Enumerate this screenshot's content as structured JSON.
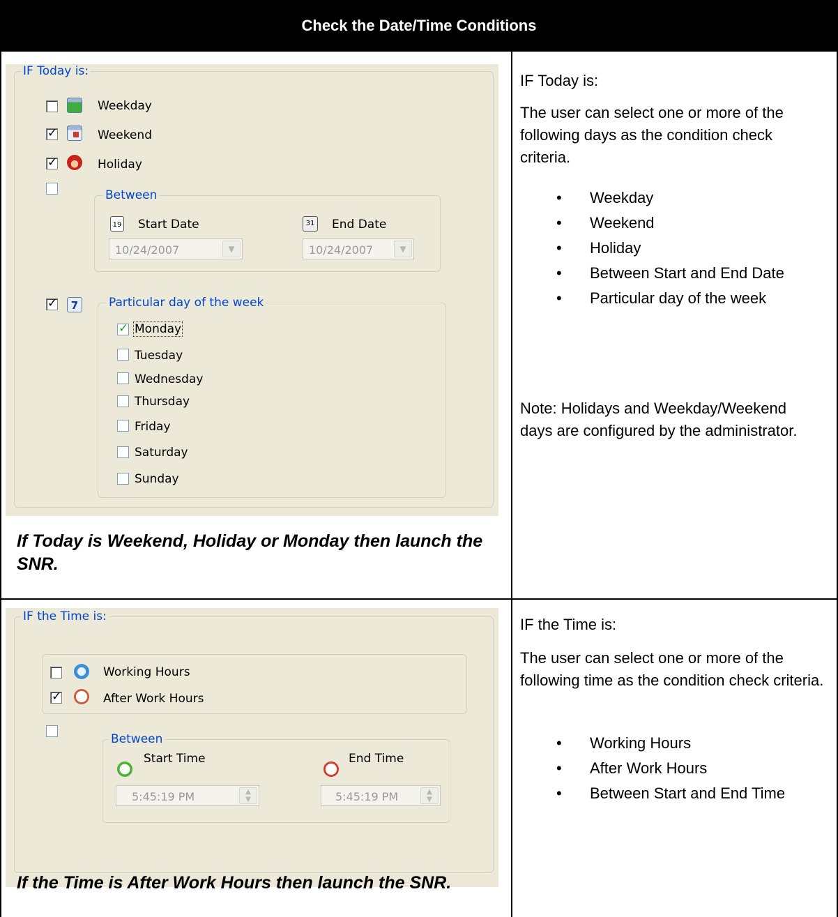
{
  "header": {
    "title": "Check the Date/Time Conditions"
  },
  "date_section": {
    "group_title": "IF Today is:",
    "options": [
      {
        "label": "Weekday",
        "checked": false,
        "icon": "weekday-calendar-icon"
      },
      {
        "label": "Weekend",
        "checked": true,
        "icon": "weekend-calendar-icon"
      },
      {
        "label": "Holiday",
        "checked": true,
        "icon": "holiday-santa-icon"
      }
    ],
    "between": {
      "checked": false,
      "title": "Between",
      "start_label": "Start Date",
      "start_icon_text": "19",
      "start_value": "10/24/2007",
      "end_label": "End Date",
      "end_icon_text": "31",
      "end_value": "10/24/2007"
    },
    "particular": {
      "checked": true,
      "icon_text": "7",
      "title": "Particular day of the week",
      "days": [
        {
          "label": "Monday",
          "checked": true
        },
        {
          "label": "Tuesday",
          "checked": false
        },
        {
          "label": "Wednesday",
          "checked": false
        },
        {
          "label": "Thursday",
          "checked": false
        },
        {
          "label": "Friday",
          "checked": false
        },
        {
          "label": "Saturday",
          "checked": false
        },
        {
          "label": "Sunday",
          "checked": false
        }
      ]
    },
    "caption": "If Today is Weekend, Holiday or Monday then launch the SNR.",
    "desc_heading": "IF Today is:",
    "desc_body": "The user can select one or more of the following days as the condition check criteria.",
    "desc_bullets": [
      "Weekday",
      "Weekend",
      "Holiday",
      "Between Start and End Date",
      "Particular day of the week"
    ],
    "note": "Note: Holidays and Weekday/Weekend days are configured by the administrator."
  },
  "time_section": {
    "group_title": "IF the Time is:",
    "options": [
      {
        "label": "Working Hours",
        "checked": false,
        "icon": "working-hours-clock-icon"
      },
      {
        "label": "After Work Hours",
        "checked": true,
        "icon": "after-hours-clock-icon"
      }
    ],
    "between": {
      "checked": false,
      "title": "Between",
      "start_label": "Start Time",
      "start_value": "5:45:19 PM",
      "end_label": "End Time",
      "end_value": "5:45:19 PM"
    },
    "caption": "If the Time is After Work Hours then launch the SNR.",
    "desc_heading": "IF the Time is:",
    "desc_body": "The user can select one or more of the following time as the condition check criteria.",
    "desc_bullets": [
      "Working Hours",
      "After Work Hours",
      "Between Start and End Time"
    ]
  },
  "colors": {
    "panel_bg": "#ece9d8",
    "groupbox_title": "#0046d5",
    "header_bg": "#000000"
  }
}
